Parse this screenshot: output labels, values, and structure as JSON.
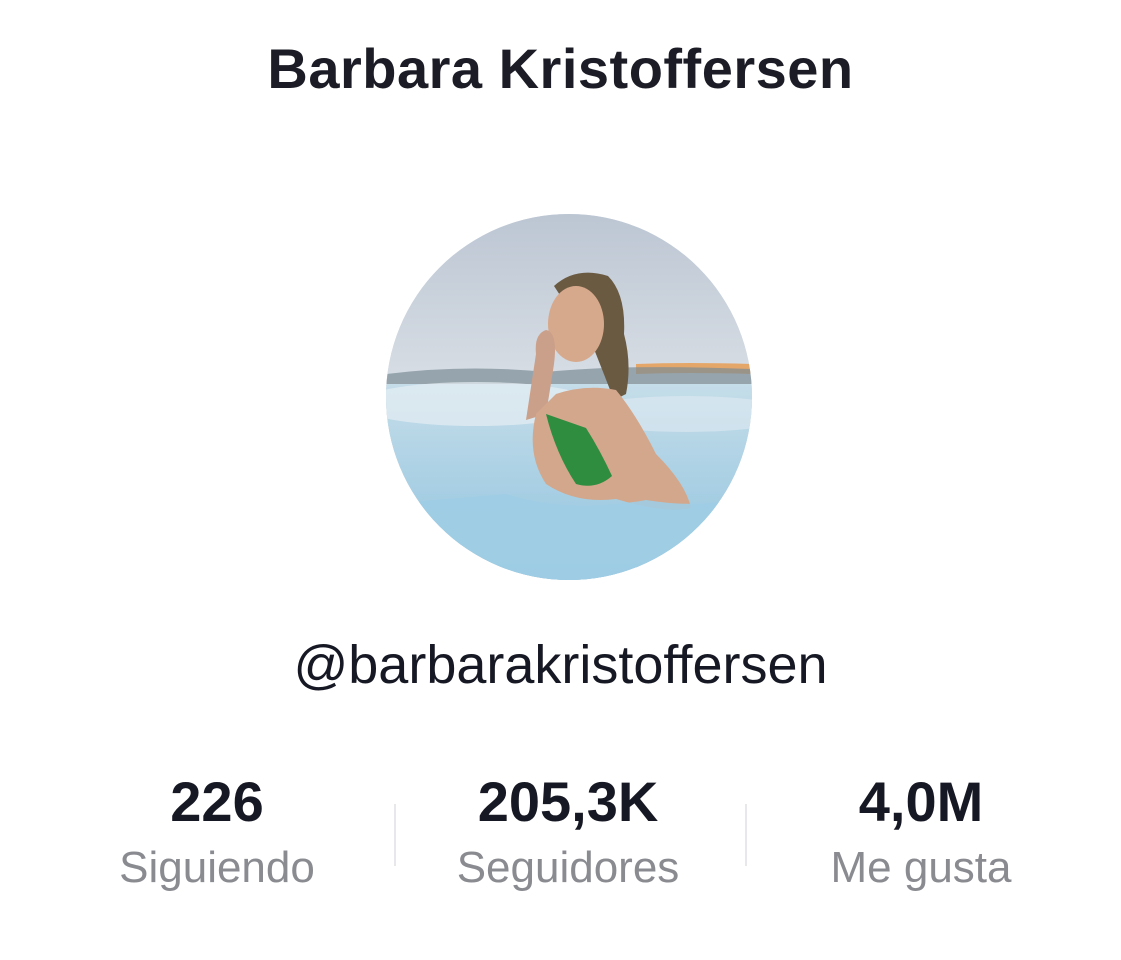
{
  "header": {
    "title": "Barbara Kristoffersen"
  },
  "profile": {
    "avatar_icon": "profile-photo",
    "username": "@barbarakristoffersen"
  },
  "stats": [
    {
      "value": "226",
      "label": "Siguiendo"
    },
    {
      "value": "205,3K",
      "label": "Seguidores"
    },
    {
      "value": "4,0M",
      "label": "Me gusta"
    }
  ],
  "colors": {
    "text_primary": "#161823",
    "text_secondary": "#8a8b91",
    "divider": "#e8e8ea",
    "background": "#ffffff"
  }
}
